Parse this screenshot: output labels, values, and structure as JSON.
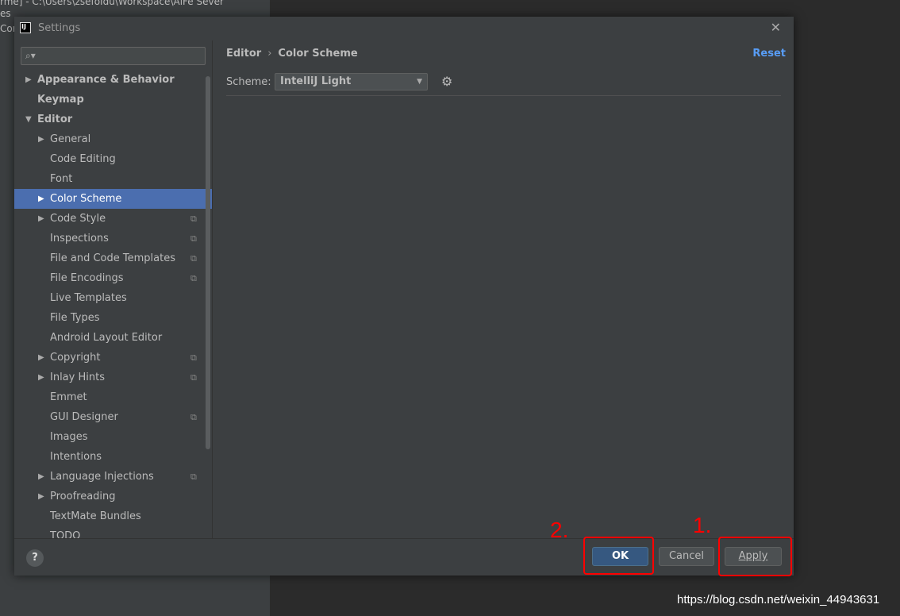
{
  "background": {
    "lines": [
      "rme] - C:\\Users\\zsefoIdu\\Workspace\\AiFe Sever",
      "es",
      "Cor"
    ]
  },
  "dialog": {
    "title": "Settings",
    "app_icon": "IJ"
  },
  "sidebar": {
    "search_placeholder": "",
    "items": [
      {
        "label": "Appearance & Behavior",
        "arrow": "▶"
      },
      {
        "label": "Keymap",
        "arrow": ""
      },
      {
        "label": "Editor",
        "arrow": "▼"
      },
      {
        "label": "General",
        "arrow": "▶"
      },
      {
        "label": "Code Editing",
        "arrow": ""
      },
      {
        "label": "Font",
        "arrow": ""
      },
      {
        "label": "Color Scheme",
        "arrow": "▶"
      },
      {
        "label": "Code Style",
        "arrow": "▶"
      },
      {
        "label": "Inspections",
        "arrow": ""
      },
      {
        "label": "File and Code Templates",
        "arrow": ""
      },
      {
        "label": "File Encodings",
        "arrow": ""
      },
      {
        "label": "Live Templates",
        "arrow": ""
      },
      {
        "label": "File Types",
        "arrow": ""
      },
      {
        "label": "Android Layout Editor",
        "arrow": ""
      },
      {
        "label": "Copyright",
        "arrow": "▶"
      },
      {
        "label": "Inlay Hints",
        "arrow": "▶"
      },
      {
        "label": "Emmet",
        "arrow": ""
      },
      {
        "label": "GUI Designer",
        "arrow": ""
      },
      {
        "label": "Images",
        "arrow": ""
      },
      {
        "label": "Intentions",
        "arrow": ""
      },
      {
        "label": "Language Injections",
        "arrow": "▶"
      },
      {
        "label": "Proofreading",
        "arrow": "▶"
      },
      {
        "label": "TextMate Bundles",
        "arrow": ""
      },
      {
        "label": "TODO",
        "arrow": ""
      }
    ]
  },
  "main": {
    "breadcrumb": {
      "parent": "Editor",
      "separator": "›",
      "current": "Color Scheme"
    },
    "reset_label": "Reset",
    "scheme_label": "Scheme:",
    "scheme_value": "IntelliJ Light"
  },
  "buttons": {
    "help": "?",
    "ok": "OK",
    "cancel": "Cancel",
    "apply": "Apply"
  },
  "annotations": {
    "step1": "1.",
    "step2": "2."
  },
  "watermark": "https://blog.csdn.net/weixin_44943631",
  "colors": {
    "selection": "#4b6eaf",
    "link": "#589df6",
    "annotation": "#ff0000",
    "ok_button": "#365880"
  }
}
